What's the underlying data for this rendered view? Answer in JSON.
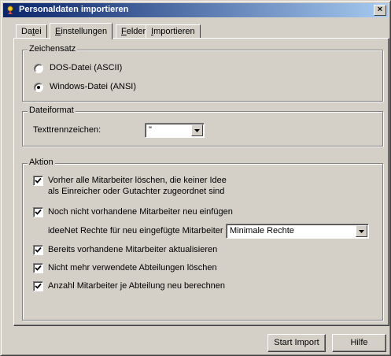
{
  "window": {
    "title": "Personaldaten importieren",
    "close_label": "×"
  },
  "tabs": [
    {
      "label": "Datei",
      "mnemonic_prefix": "Da",
      "mnemonic": "t",
      "mnemonic_suffix": "ei"
    },
    {
      "label": "Einstellungen",
      "mnemonic_prefix": "",
      "mnemonic": "E",
      "mnemonic_suffix": "instellungen"
    },
    {
      "label": "Felder",
      "mnemonic_prefix": "",
      "mnemonic": "F",
      "mnemonic_suffix": "elder"
    },
    {
      "label": "Importieren",
      "mnemonic_prefix": "",
      "mnemonic": "I",
      "mnemonic_suffix": "mportieren"
    }
  ],
  "active_tab": "Einstellungen",
  "zeichensatz": {
    "legend": "Zeichensatz",
    "options": [
      {
        "label": "DOS-Datei (ASCII)",
        "selected": false
      },
      {
        "label": "Windows-Datei (ANSI)",
        "selected": true
      }
    ]
  },
  "dateiformat": {
    "legend": "Dateiformat",
    "separator_label": "Texttrennzeichen:",
    "separator_value": "\""
  },
  "aktion": {
    "legend": "Aktion",
    "delete_label_1": "Vorher alle Mitarbeiter löschen, die keiner Idee",
    "delete_label_2": "als Einreicher oder Gutachter zugeordnet sind",
    "insert_label": "Noch nicht vorhandene Mitarbeiter neu einfügen",
    "rights_label": "ideeNet Rechte für neu eingefügte Mitarbeiter",
    "rights_value": "Minimale Rechte",
    "update_label": "Bereits vorhandene Mitarbeiter aktualisieren",
    "dept_delete_label": "Nicht mehr verwendete Abteilungen löschen",
    "recalc_label": "Anzahl Mitarbeiter je Abteilung neu berechnen"
  },
  "buttons": {
    "start_import": "Start Import",
    "help": "Hilfe"
  },
  "colors": {
    "face": "#d4d0c8",
    "title_start": "#0a246a",
    "title_end": "#a6caf0"
  }
}
